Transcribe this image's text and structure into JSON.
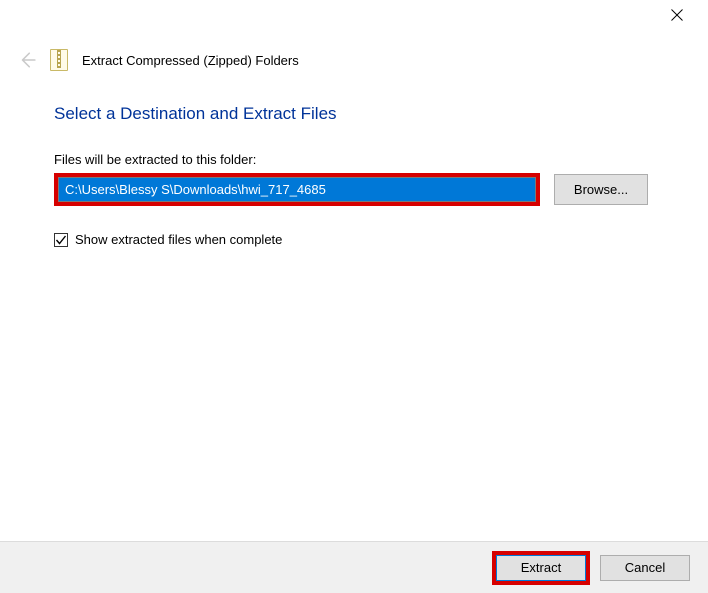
{
  "window": {
    "title": "Extract Compressed (Zipped) Folders"
  },
  "main": {
    "heading": "Select a Destination and Extract Files",
    "path_label": "Files will be extracted to this folder:",
    "path_value": "C:\\Users\\Blessy S\\Downloads\\hwi_717_4685",
    "browse_label": "Browse...",
    "checkbox_label": "Show extracted files when complete"
  },
  "footer": {
    "extract_label": "Extract",
    "cancel_label": "Cancel"
  }
}
